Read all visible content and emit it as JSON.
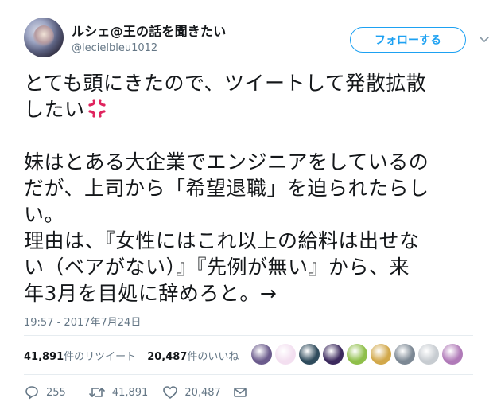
{
  "user": {
    "display_name": "ルシェ@王の話を聞きたい",
    "screen_name": "@lecielbleu1012"
  },
  "follow_button": {
    "label": "フォローする"
  },
  "tweet": {
    "lines_1": [
      "とても頭にきたので、ツイートして発散拡散",
      "したい"
    ],
    "emoji": "anger-symbol-icon",
    "lines_2": [
      "妹はとある大企業でエンジニアをしているの",
      "だが、上司から「希望退職」を迫られたらし",
      "い。",
      "理由は、『女性にはこれ以上の給料は出せな",
      "い（ベアがない）』『先例が無い』から、来",
      "年3月を目処に辞めろと。→"
    ]
  },
  "timestamp": "19:57 - 2017年7月24日",
  "stats": {
    "retweets": {
      "count": "41,891",
      "label": "件のリツイート"
    },
    "likes": {
      "count": "20,487",
      "label": "件のいいね"
    }
  },
  "liker_avatars": [
    {
      "color": "#6b5b8c"
    },
    {
      "color": "#f3dff0"
    },
    {
      "color": "#2f4b5c"
    },
    {
      "color": "#3c2a5e"
    },
    {
      "color": "#8fbf4a"
    },
    {
      "color": "#d2a84a"
    },
    {
      "color": "#7c8894"
    },
    {
      "color": "#c7ccd1"
    },
    {
      "color": "#b07ab8"
    }
  ],
  "actions": {
    "reply_count": "255",
    "retweet_count": "41,891",
    "like_count": "20,487"
  },
  "colors": {
    "accent": "#1da1f2",
    "text": "#14171a",
    "secondary": "#657786",
    "divider": "#e6ecf0",
    "anger": "#e0245e"
  }
}
